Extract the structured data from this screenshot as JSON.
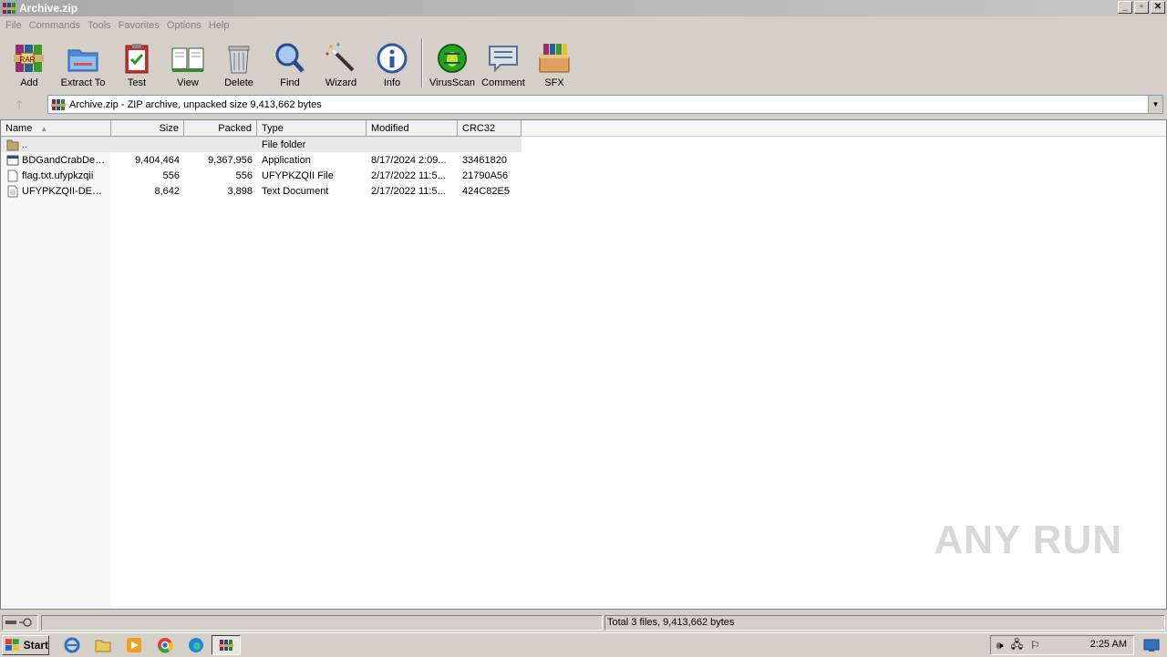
{
  "window": {
    "title": "Archive.zip"
  },
  "menu": [
    "File",
    "Commands",
    "Tools",
    "Favorites",
    "Options",
    "Help"
  ],
  "toolbar": [
    {
      "label": "Add",
      "icon": "add-archive-icon"
    },
    {
      "label": "Extract To",
      "icon": "extract-folder-icon"
    },
    {
      "label": "Test",
      "icon": "test-clipboard-icon"
    },
    {
      "label": "View",
      "icon": "view-book-icon"
    },
    {
      "label": "Delete",
      "icon": "trash-icon"
    },
    {
      "label": "Find",
      "icon": "magnifier-icon"
    },
    {
      "label": "Wizard",
      "icon": "magic-wand-icon"
    },
    {
      "label": "Info",
      "icon": "info-icon"
    },
    {
      "label": "VirusScan",
      "icon": "virus-bug-icon"
    },
    {
      "label": "Comment",
      "icon": "comment-icon"
    },
    {
      "label": "SFX",
      "icon": "sfx-box-icon"
    }
  ],
  "address": {
    "text": "Archive.zip - ZIP archive, unpacked size 9,413,662 bytes"
  },
  "columns": [
    "Name",
    "Size",
    "Packed",
    "Type",
    "Modified",
    "CRC32"
  ],
  "files": [
    {
      "name": "..",
      "size": "",
      "packed": "",
      "type": "File folder",
      "modified": "",
      "crc": "",
      "icon": "folder-icon"
    },
    {
      "name": "BDGandCrabDecr...",
      "size": "9,404,464",
      "packed": "9,367,956",
      "type": "Application",
      "modified": "8/17/2024 2:09...",
      "crc": "33461820",
      "icon": "application-icon"
    },
    {
      "name": "flag.txt.ufypkzqii",
      "size": "556",
      "packed": "556",
      "type": "UFYPKZQII File",
      "modified": "2/17/2022 11:5...",
      "crc": "21790A56",
      "icon": "file-icon"
    },
    {
      "name": "UFYPKZQII-DECR...",
      "size": "8,642",
      "packed": "3,898",
      "type": "Text Document",
      "modified": "2/17/2022 11:5...",
      "crc": "424C82E5",
      "icon": "text-document-icon"
    }
  ],
  "status": {
    "total": "Total 3 files, 9,413,662 bytes"
  },
  "watermark": "ANY RUN",
  "taskbar": {
    "start_label": "Start",
    "clock": "2:25 AM"
  }
}
